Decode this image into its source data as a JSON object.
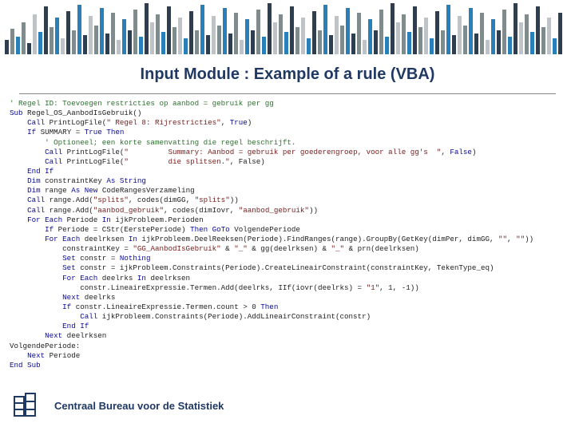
{
  "title": "Input Module : Example of a rule (VBA)",
  "footer": {
    "text": "Centraal Bureau voor de Statistiek"
  },
  "bars": {
    "heights": [
      18,
      32,
      22,
      40,
      14,
      50,
      28,
      60,
      34,
      46,
      20,
      54,
      30,
      62,
      24,
      48,
      36,
      58,
      26,
      52,
      18,
      44,
      30,
      56,
      22,
      64,
      40,
      50,
      28,
      60,
      34,
      46,
      20,
      54,
      30,
      62,
      24,
      48,
      36,
      58,
      26,
      52,
      18,
      44,
      30,
      56,
      22,
      64,
      40,
      50,
      28,
      60,
      34,
      46,
      20,
      54,
      30,
      62,
      24,
      48,
      36,
      58,
      26,
      52,
      18,
      44,
      30,
      56,
      22,
      64,
      40,
      50,
      28,
      60,
      34,
      46,
      20,
      54,
      30,
      62,
      24,
      48,
      36,
      58,
      26,
      52,
      18,
      44,
      30,
      56,
      22,
      64,
      40,
      50,
      28,
      60,
      34,
      46,
      20,
      52
    ],
    "colors": [
      "#2c3e50",
      "#7f8c8d",
      "#2980b9",
      "#7f8c8d",
      "#2c3e50",
      "#bdc3c7",
      "#2980b9",
      "#2c3e50",
      "#7f8c8d",
      "#2980b9",
      "#bdc3c7",
      "#2c3e50",
      "#7f8c8d",
      "#2980b9",
      "#2c3e50",
      "#bdc3c7",
      "#7f8c8d",
      "#2980b9",
      "#2c3e50",
      "#7f8c8d",
      "#bdc3c7",
      "#2980b9",
      "#2c3e50",
      "#7f8c8d",
      "#2980b9",
      "#2c3e50",
      "#bdc3c7",
      "#7f8c8d",
      "#2980b9",
      "#2c3e50",
      "#7f8c8d",
      "#bdc3c7",
      "#2980b9",
      "#2c3e50",
      "#7f8c8d",
      "#2980b9",
      "#2c3e50",
      "#bdc3c7",
      "#7f8c8d",
      "#2980b9",
      "#2c3e50",
      "#7f8c8d",
      "#bdc3c7",
      "#2980b9",
      "#2c3e50",
      "#7f8c8d",
      "#2980b9",
      "#2c3e50",
      "#bdc3c7",
      "#7f8c8d",
      "#2980b9",
      "#2c3e50",
      "#7f8c8d",
      "#bdc3c7",
      "#2980b9",
      "#2c3e50",
      "#7f8c8d",
      "#2980b9",
      "#2c3e50",
      "#bdc3c7",
      "#7f8c8d",
      "#2980b9",
      "#2c3e50",
      "#7f8c8d",
      "#bdc3c7",
      "#2980b9",
      "#2c3e50",
      "#7f8c8d",
      "#2980b9",
      "#2c3e50",
      "#bdc3c7",
      "#7f8c8d",
      "#2980b9",
      "#2c3e50",
      "#7f8c8d",
      "#bdc3c7",
      "#2980b9",
      "#2c3e50",
      "#7f8c8d",
      "#2980b9",
      "#2c3e50",
      "#bdc3c7",
      "#7f8c8d",
      "#2980b9",
      "#2c3e50",
      "#7f8c8d",
      "#bdc3c7",
      "#2980b9",
      "#2c3e50",
      "#7f8c8d",
      "#2980b9",
      "#2c3e50",
      "#bdc3c7",
      "#7f8c8d",
      "#2980b9",
      "#2c3e50",
      "#7f8c8d",
      "#bdc3c7",
      "#2980b9",
      "#2c3e50"
    ]
  },
  "code": {
    "lines": [
      [
        {
          "c": "cmt",
          "t": "' Regel ID: Toevoegen restricties op aanbod = gebruik per gg"
        }
      ],
      [
        {
          "c": "kw",
          "t": "Sub"
        },
        {
          "t": " Regel_OS_AanbodIsGebruik()"
        }
      ],
      [
        {
          "t": "    "
        },
        {
          "c": "kw",
          "t": "Call"
        },
        {
          "t": " PrintLogFile("
        },
        {
          "c": "str",
          "t": "\" Regel 8: Rijrestricties\""
        },
        {
          "t": ", "
        },
        {
          "c": "kw",
          "t": "True"
        },
        {
          "t": ")"
        }
      ],
      [
        {
          "t": "    "
        },
        {
          "c": "kw",
          "t": "If"
        },
        {
          "t": " SUMMARY = "
        },
        {
          "c": "kw",
          "t": "True"
        },
        {
          "t": " "
        },
        {
          "c": "kw",
          "t": "Then"
        }
      ],
      [
        {
          "t": "        "
        },
        {
          "c": "cmt",
          "t": "' Optioneel; een korte samenvatting die regel beschrijft."
        }
      ],
      [
        {
          "t": "        "
        },
        {
          "c": "kw",
          "t": "Call"
        },
        {
          "t": " PrintLogFile("
        },
        {
          "c": "str",
          "t": "\"         Summary: Aanbod = gebruik per goederengroep, voor alle gg's  \""
        },
        {
          "t": ", "
        },
        {
          "c": "kw",
          "t": "False"
        },
        {
          "t": ")"
        }
      ],
      [
        {
          "t": "        "
        },
        {
          "c": "kw",
          "t": "Call"
        },
        {
          "t": " PrintLogFile("
        },
        {
          "c": "str",
          "t": "\"         die splitsen.\""
        },
        {
          "t": ", False)"
        }
      ],
      [
        {
          "t": "    "
        },
        {
          "c": "kw",
          "t": "End If"
        }
      ],
      [
        {
          "t": "    "
        },
        {
          "c": "kw",
          "t": "Dim"
        },
        {
          "t": " constraintKey "
        },
        {
          "c": "kw",
          "t": "As String"
        }
      ],
      [
        {
          "t": "    "
        },
        {
          "c": "kw",
          "t": "Dim"
        },
        {
          "t": " range "
        },
        {
          "c": "kw",
          "t": "As New"
        },
        {
          "t": " CodeRangesVerzameling"
        }
      ],
      [
        {
          "t": "    "
        },
        {
          "c": "kw",
          "t": "Call"
        },
        {
          "t": " range.Add("
        },
        {
          "c": "str",
          "t": "\"splits\""
        },
        {
          "t": ", codes(dimGG, "
        },
        {
          "c": "str",
          "t": "\"splits\""
        },
        {
          "t": "))"
        }
      ],
      [
        {
          "t": "    "
        },
        {
          "c": "kw",
          "t": "Call"
        },
        {
          "t": " range.Add("
        },
        {
          "c": "str",
          "t": "\"aanbod_gebruik\""
        },
        {
          "t": ", codes(dimIovr, "
        },
        {
          "c": "str",
          "t": "\"aanbod_gebruik\""
        },
        {
          "t": "))"
        }
      ],
      [
        {
          "t": "    "
        },
        {
          "c": "kw",
          "t": "For Each"
        },
        {
          "t": " Periode "
        },
        {
          "c": "kw",
          "t": "In"
        },
        {
          "t": " ijkProbleem.Perioden"
        }
      ],
      [
        {
          "t": "        "
        },
        {
          "c": "kw",
          "t": "If"
        },
        {
          "t": " Periode = CStr(EerstePeriode) "
        },
        {
          "c": "kw",
          "t": "Then GoTo"
        },
        {
          "t": " VolgendePeriode"
        }
      ],
      [
        {
          "t": "        "
        },
        {
          "c": "kw",
          "t": "For Each"
        },
        {
          "t": " deelrksen "
        },
        {
          "c": "kw",
          "t": "In"
        },
        {
          "t": " ijkProbleem.DeelReeksen(Periode).FindRanges(range).GroupBy(GetKey(dimPer, dimGG, "
        },
        {
          "c": "str",
          "t": "\"\""
        },
        {
          "t": ", "
        },
        {
          "c": "str",
          "t": "\"\""
        },
        {
          "t": "))"
        }
      ],
      [
        {
          "t": "            constraintKey = "
        },
        {
          "c": "str",
          "t": "\"GG_AanbodIsGebruik\""
        },
        {
          "t": " & "
        },
        {
          "c": "str",
          "t": "\"_\""
        },
        {
          "t": " & gg(deelrksen) & "
        },
        {
          "c": "str",
          "t": "\"_\""
        },
        {
          "t": " & prn(deelrksen)"
        }
      ],
      [
        {
          "t": "            "
        },
        {
          "c": "kw",
          "t": "Set"
        },
        {
          "t": " constr = "
        },
        {
          "c": "kw",
          "t": "Nothing"
        }
      ],
      [
        {
          "t": "            "
        },
        {
          "c": "kw",
          "t": "Set"
        },
        {
          "t": " constr = ijkProbleem.Constraints(Periode).CreateLineairConstraint(constraintKey, TekenType_eq)"
        }
      ],
      [
        {
          "t": "            "
        },
        {
          "c": "kw",
          "t": "For Each"
        },
        {
          "t": " deelrks "
        },
        {
          "c": "kw",
          "t": "In"
        },
        {
          "t": " deelrksen"
        }
      ],
      [
        {
          "t": "                constr.LineaireExpressie.Termen.Add(deelrks, IIf(iovr(deelrks) = "
        },
        {
          "c": "str",
          "t": "\"1\""
        },
        {
          "t": ", 1, -1))"
        }
      ],
      [
        {
          "t": "            "
        },
        {
          "c": "kw",
          "t": "Next"
        },
        {
          "t": " deelrks"
        }
      ],
      [
        {
          "t": "            "
        },
        {
          "c": "kw",
          "t": "If"
        },
        {
          "t": " constr.LineaireExpressie.Termen.count > 0 "
        },
        {
          "c": "kw",
          "t": "Then"
        }
      ],
      [
        {
          "t": "                "
        },
        {
          "c": "kw",
          "t": "Call"
        },
        {
          "t": " ijkProbleem.Constraints(Periode).AddLineairConstraint(constr)"
        }
      ],
      [
        {
          "t": "            "
        },
        {
          "c": "kw",
          "t": "End If"
        }
      ],
      [
        {
          "t": "        "
        },
        {
          "c": "kw",
          "t": "Next"
        },
        {
          "t": " deelrksen"
        }
      ],
      [
        {
          "t": "VolgendePeriode:"
        }
      ],
      [
        {
          "t": "    "
        },
        {
          "c": "kw",
          "t": "Next"
        },
        {
          "t": " Periode"
        }
      ],
      [
        {
          "c": "kw",
          "t": "End Sub"
        }
      ]
    ]
  }
}
